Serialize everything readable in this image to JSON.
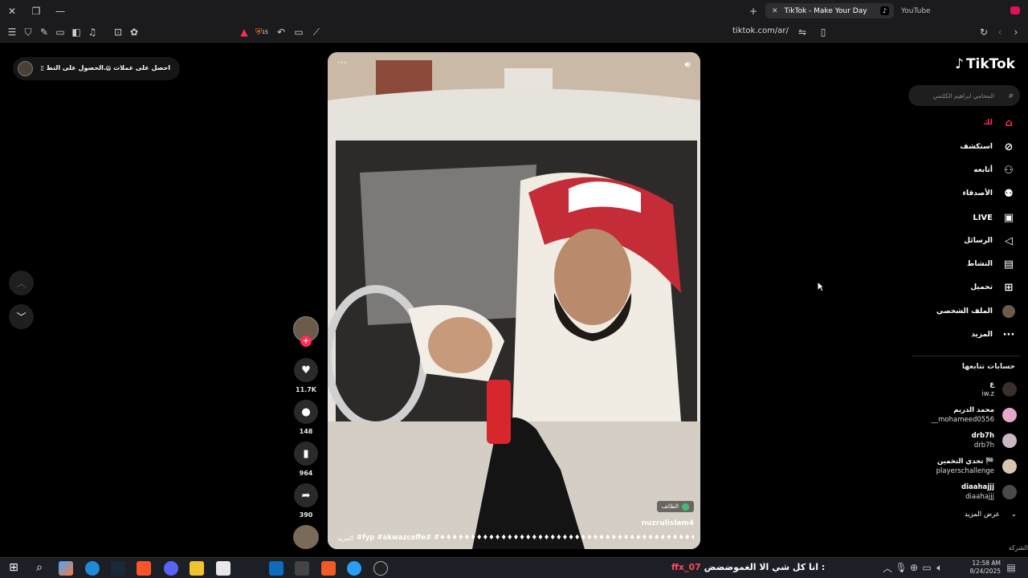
{
  "browser": {
    "tab_active_title": "TikTok - Make Your Day",
    "tab_other_title": "YouTube",
    "url": "tiktok.com/ar/",
    "shield_count": "15"
  },
  "promo": {
    "get_coins": "احصل على عملات",
    "get_app": "الحصول على التط..."
  },
  "video": {
    "username": "nuzrulislam4",
    "location_badge": "الطائف",
    "caption": "#fyp #akwazcoffe# #♦♦♦♦♦♦♦♦♦♦♦♦♦♦♦♦♦♦♦♦♦♦♦♦♦♦♦♦♦♦♦♦♦♦♦♦♦♦♦♦♦♦♦ #explore ...",
    "more": "المزيد",
    "dots": "···"
  },
  "actions": {
    "likes": "11.7K",
    "comments": "148",
    "saves": "964",
    "shares": "390"
  },
  "sidebar": {
    "logo": "TikTok",
    "search_placeholder": "المحامي ابراهيم الكلثمي",
    "items": [
      {
        "label": "لك",
        "icon": "home-icon"
      },
      {
        "label": "استكشف",
        "icon": "compass-icon"
      },
      {
        "label": "أتابعه",
        "icon": "user-follow-icon"
      },
      {
        "label": "الأصدقاء",
        "icon": "friends-icon"
      },
      {
        "label": "LIVE",
        "icon": "live-icon"
      },
      {
        "label": "الرسائل",
        "icon": "send-icon"
      },
      {
        "label": "النشاط",
        "icon": "activity-icon"
      },
      {
        "label": "تحميل",
        "icon": "upload-icon"
      },
      {
        "label": "الملف الشخصي",
        "icon": "avatar"
      },
      {
        "label": "المزيد",
        "icon": "more-icon"
      }
    ],
    "following_header": "حسابات تتابعها",
    "accounts": [
      {
        "name": "ع",
        "handle": "iw.z"
      },
      {
        "name": "محمد الدريم",
        "handle": "__mohameed0556"
      },
      {
        "name": "drb7h",
        "handle": "drb7h"
      },
      {
        "name": "تحدي التخمين 🏁",
        "handle": "playerschallenge"
      },
      {
        "name": "diaahajjj",
        "handle": "diaahajjj"
      }
    ],
    "see_more": "عرض المزيد",
    "corner": "الشركة"
  },
  "taskbar": {
    "ticker_left": "ffx_07",
    "ticker_text": "انا كل شي الا الغموضضض :",
    "time": "12:58 AM",
    "date": "8/24/2025"
  },
  "colors": {
    "accent": "#fe2c55",
    "background": "#000000",
    "chrome": "#1b1b1d"
  }
}
